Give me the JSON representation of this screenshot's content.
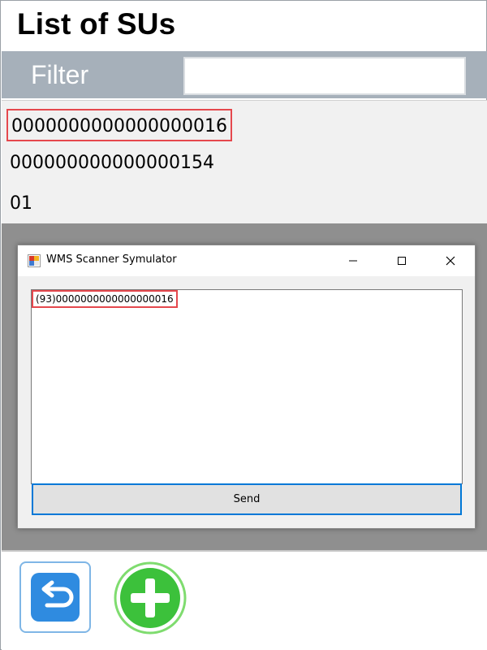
{
  "header": {
    "title": "List of SUs"
  },
  "filter": {
    "label": "Filter",
    "value": ""
  },
  "su_list": {
    "items": [
      {
        "label": "0000000000000000016",
        "selected": true
      },
      {
        "label": "000000000000000154",
        "selected": false
      },
      {
        "label": "01",
        "selected": false
      }
    ]
  },
  "scanner_window": {
    "title": "WMS Scanner Symulator",
    "scan_text": "(93)0000000000000000016",
    "send_label": "Send",
    "controls": [
      "minimize-icon",
      "maximize-icon",
      "close-icon"
    ]
  },
  "toolbar": {
    "back_icon": "undo-arrow-icon",
    "add_icon": "plus-circle-icon"
  },
  "colors": {
    "filter_bar": "#a6b0ba",
    "highlight": "#e5484d",
    "accent_blue": "#0078d7",
    "back_blue": "#2f8be0",
    "add_green": "#3cc13b"
  }
}
